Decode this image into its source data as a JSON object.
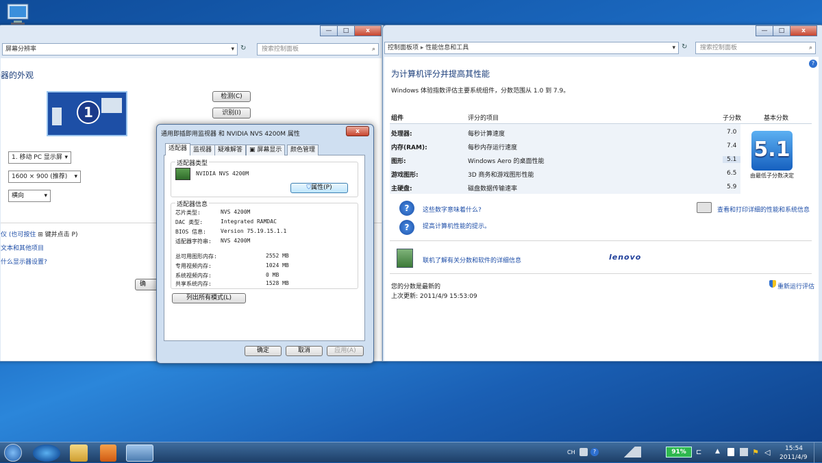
{
  "desktop": {
    "icon_label": "计算机"
  },
  "left_window": {
    "breadcrumb": "屏幕分辨率",
    "search_placeholder": "搜索控制面板",
    "heading": "器的外观",
    "monitor_number": "1",
    "detect_button": "检测(C)",
    "identify_button": "识别(I)",
    "display_select": "1. 移动 PC 显示屏",
    "resolution_select": "1600 × 900 (推荐)",
    "orientation_select": "横向",
    "hint_text": "仪 (也可按住",
    "hint_text2": "键并点击 P)",
    "link_text_size": "文本和其他项目",
    "link_settings": "什么显示器设置?",
    "ok_button_partial": "确"
  },
  "dialog": {
    "title": "通用即插即用监视器 和 NVIDIA NVS 4200M   属性",
    "close": "x",
    "tabs": [
      "适配器",
      "监视器",
      "疑难解答",
      "屏幕显示",
      "颜色管理"
    ],
    "adapter_type_label": "适配器类型",
    "adapter_name": "NVIDIA NVS 4200M",
    "properties_button": "属性(P)",
    "adapter_info_label": "适配器信息",
    "info": [
      {
        "k": "芯片类型:",
        "v": "NVS 4200M"
      },
      {
        "k": "DAC 类型:",
        "v": "Integrated RAMDAC"
      },
      {
        "k": "BIOS 信息:",
        "v": "Version 75.19.15.1.1"
      },
      {
        "k": "适配器字符串:",
        "v": "NVS 4200M"
      }
    ],
    "memory": [
      {
        "k": "总可用图形内存:",
        "v": "2552 MB"
      },
      {
        "k": "专用视频内存:",
        "v": "1024 MB"
      },
      {
        "k": "系统视频内存:",
        "v": "0 MB"
      },
      {
        "k": "共享系统内存:",
        "v": "1528 MB"
      }
    ],
    "list_modes_button": "列出所有模式(L)",
    "ok": "确定",
    "cancel": "取消",
    "apply": "应用(A)"
  },
  "right_window": {
    "breadcrumb_1": "控制面板项",
    "breadcrumb_2": "性能信息和工具",
    "search_placeholder": "搜索控制面板",
    "heading": "为计算机评分并提高其性能",
    "subtitle": "Windows 体验指数评估主要系统组件，分数范围从 1.0 到 7.9。",
    "col_component": "组件",
    "col_item": "评分的项目",
    "col_subscore": "子分数",
    "col_base": "基本分数",
    "rows": [
      {
        "c": "处理器:",
        "i": "每秒计算速度",
        "s": "7.0"
      },
      {
        "c": "内存(RAM):",
        "i": "每秒内存运行速度",
        "s": "7.4"
      },
      {
        "c": "图形:",
        "i": "Windows Aero 的桌面性能",
        "s": "5.1"
      },
      {
        "c": "游戏图形:",
        "i": "3D 商务和游戏图形性能",
        "s": "6.5"
      },
      {
        "c": "主硬盘:",
        "i": "磁盘数据传输速率",
        "s": "5.9"
      }
    ],
    "base_score": "5.1",
    "base_caption": "由最低子分数决定",
    "link_meaning": "这些数字意味着什么?",
    "link_tips": "提高计算机性能的提示。",
    "link_print": "查看和打印详细的性能和系统信息",
    "link_learn": "联机了解有关分数和软件的详细信息",
    "brand": "lenovo",
    "status": "您的分数是最新的",
    "last_update": "上次更新: 2011/4/9 15:53:09",
    "rerun": "重新运行评估"
  },
  "taskbar": {
    "lang": "CH",
    "battery": "91%",
    "time": "15:54",
    "date": "2011/4/9"
  }
}
